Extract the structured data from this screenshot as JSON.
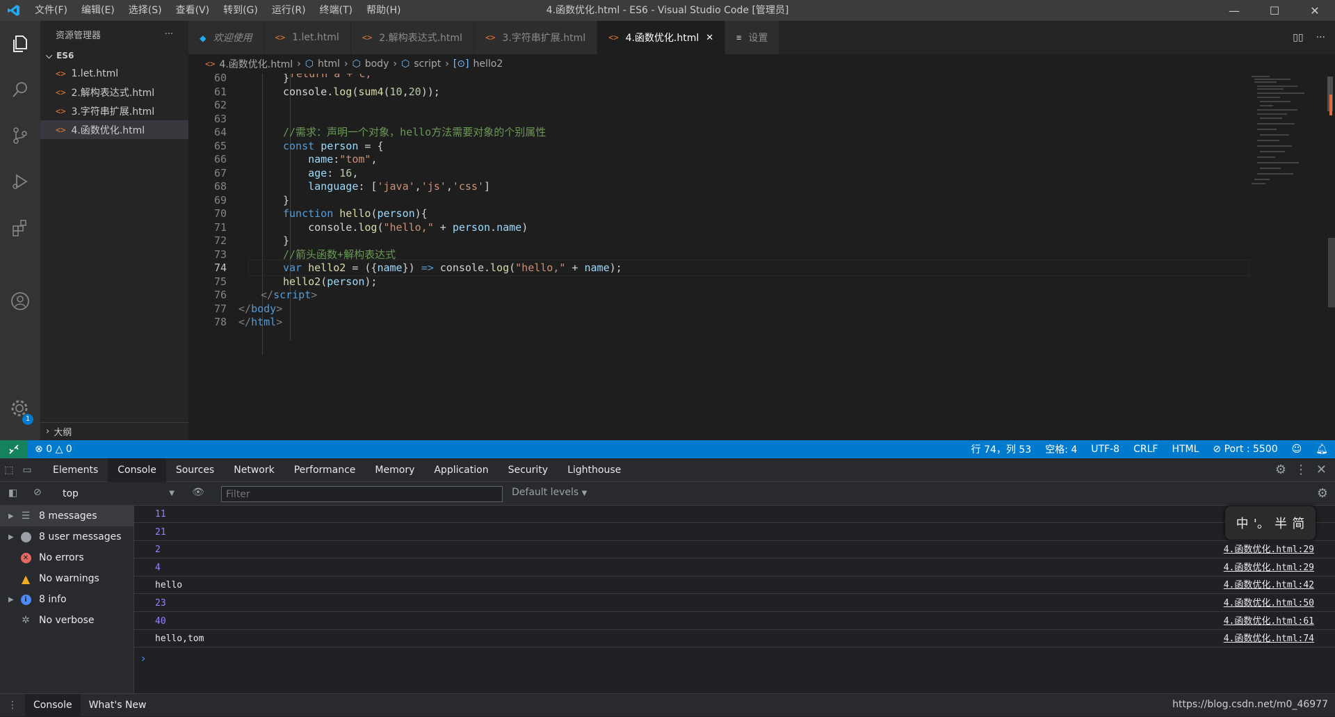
{
  "titlebar": {
    "menu": [
      "文件(F)",
      "编辑(E)",
      "选择(S)",
      "查看(V)",
      "转到(G)",
      "运行(R)",
      "终端(T)",
      "帮助(H)"
    ],
    "title": "4.函数优化.html - ES6 - Visual Studio Code [管理员]"
  },
  "sidebar": {
    "header": "资源管理器",
    "folder": "ES6",
    "files": [
      "1.let.html",
      "2.解构表达式.html",
      "3.字符串扩展.html",
      "4.函数优化.html"
    ],
    "outline": "大纲",
    "settings_badge": "1"
  },
  "tabs": [
    {
      "label": "欢迎使用",
      "icon": "vscode-icon"
    },
    {
      "label": "1.let.html",
      "icon": "html-icon"
    },
    {
      "label": "2.解构表达式.html",
      "icon": "html-icon"
    },
    {
      "label": "3.字符串扩展.html",
      "icon": "html-icon"
    },
    {
      "label": "4.函数优化.html",
      "icon": "html-icon"
    },
    {
      "label": "设置",
      "icon": "settings-file-icon"
    }
  ],
  "breadcrumb": {
    "file": "4.函数优化.html",
    "html": "html",
    "body": "body",
    "script": "script",
    "symbol": "hello2"
  },
  "editor": {
    "line_numbers": [
      "60",
      "61",
      "62",
      "63",
      "64",
      "65",
      "66",
      "67",
      "68",
      "69",
      "70",
      "71",
      "72",
      "73",
      "74",
      "75",
      "76",
      "77",
      "78"
    ],
    "lines": [
      [
        [
          "p",
          "}"
        ]
      ],
      [
        [
          "p",
          "console."
        ],
        [
          "fn",
          "log"
        ],
        [
          "p",
          "("
        ],
        [
          "fn",
          "sum4"
        ],
        [
          "p",
          "("
        ],
        [
          "num",
          "10"
        ],
        [
          "p",
          ","
        ],
        [
          "num",
          "20"
        ],
        [
          "p",
          "));"
        ]
      ],
      [],
      [],
      [
        [
          "cm",
          "//需求：声明一个对象，hello方法需要对象的个别属性"
        ]
      ],
      [
        [
          "kw",
          "const "
        ],
        [
          "var",
          "person"
        ],
        [
          "p",
          " = {"
        ]
      ],
      [
        [
          "p",
          "    "
        ],
        [
          "var",
          "name"
        ],
        [
          "p",
          ":"
        ],
        [
          "str",
          "\"tom\""
        ],
        [
          "p",
          ","
        ]
      ],
      [
        [
          "p",
          "    "
        ],
        [
          "var",
          "age"
        ],
        [
          "p",
          ": "
        ],
        [
          "num",
          "16"
        ],
        [
          "p",
          ","
        ]
      ],
      [
        [
          "p",
          "    "
        ],
        [
          "var",
          "language"
        ],
        [
          "p",
          ": ["
        ],
        [
          "str",
          "'java'"
        ],
        [
          "p",
          ","
        ],
        [
          "str",
          "'js'"
        ],
        [
          "p",
          ","
        ],
        [
          "str",
          "'css'"
        ],
        [
          "p",
          "]"
        ]
      ],
      [
        [
          "p",
          "}"
        ]
      ],
      [
        [
          "kw",
          "function "
        ],
        [
          "fn",
          "hello"
        ],
        [
          "p",
          "("
        ],
        [
          "var",
          "person"
        ],
        [
          "p",
          "){"
        ]
      ],
      [
        [
          "p",
          "    console."
        ],
        [
          "fn",
          "log"
        ],
        [
          "p",
          "("
        ],
        [
          "str",
          "\"hello,\""
        ],
        [
          "p",
          " + "
        ],
        [
          "var",
          "person"
        ],
        [
          "p",
          "."
        ],
        [
          "var",
          "name"
        ],
        [
          "p",
          ")"
        ]
      ],
      [
        [
          "p",
          "}"
        ]
      ],
      [
        [
          "cm",
          "//箭头函数+解构表达式"
        ]
      ],
      [
        [
          "kw",
          "var "
        ],
        [
          "fn",
          "hello2"
        ],
        [
          "p",
          " = ({"
        ],
        [
          "var",
          "name"
        ],
        [
          "p",
          "}) "
        ],
        [
          "kw",
          "=>"
        ],
        [
          "p",
          " console."
        ],
        [
          "fn",
          "log"
        ],
        [
          "p",
          "("
        ],
        [
          "str",
          "\"hello,\""
        ],
        [
          "p",
          " + "
        ],
        [
          "var",
          "name"
        ],
        [
          "p",
          ");"
        ]
      ],
      [
        [
          "fn",
          "hello2"
        ],
        [
          "p",
          "("
        ],
        [
          "var",
          "person"
        ],
        [
          "p",
          ");"
        ]
      ],
      [
        [
          "br",
          "</"
        ],
        [
          "tag",
          "script"
        ],
        [
          "br",
          ">"
        ]
      ],
      [
        [
          "br",
          "</"
        ],
        [
          "tag",
          "body"
        ],
        [
          "br",
          ">"
        ]
      ],
      [
        [
          "br",
          "</"
        ],
        [
          "tag",
          "html"
        ],
        [
          "br",
          ">"
        ]
      ]
    ],
    "top_partial": "return a + c;"
  },
  "status": {
    "errors": "0",
    "warnings": "0",
    "position": "行 74，列 53",
    "spaces": "空格: 4",
    "encoding": "UTF-8",
    "eol": "CRLF",
    "language": "HTML",
    "port": "Port : 5500"
  },
  "devtools": {
    "tabs": [
      "Elements",
      "Console",
      "Sources",
      "Network",
      "Performance",
      "Memory",
      "Application",
      "Security",
      "Lighthouse"
    ],
    "active_tab": "Console",
    "context": "top",
    "filter_placeholder": "Filter",
    "levels": "Default levels",
    "sidebar": [
      {
        "label": "8 messages",
        "icon": "list-icon",
        "expandable": true
      },
      {
        "label": "8 user messages",
        "icon": "user-icon",
        "expandable": true
      },
      {
        "label": "No errors",
        "icon": "error-icon",
        "expandable": false
      },
      {
        "label": "No warnings",
        "icon": "warning-icon",
        "expandable": false
      },
      {
        "label": "8 info",
        "icon": "info-icon",
        "expandable": true
      },
      {
        "label": "No verbose",
        "icon": "bug-icon",
        "expandable": false
      }
    ],
    "console_rows": [
      {
        "value": "11",
        "type": "number",
        "source": "4."
      },
      {
        "value": "21",
        "type": "number",
        "source": "4."
      },
      {
        "value": "2",
        "type": "number",
        "source": "4.函数优化.html:29"
      },
      {
        "value": "4",
        "type": "number",
        "source": "4.函数优化.html:29"
      },
      {
        "value": "hello",
        "type": "string",
        "source": "4.函数优化.html:42"
      },
      {
        "value": "23",
        "type": "number",
        "source": "4.函数优化.html:50"
      },
      {
        "value": "40",
        "type": "number",
        "source": "4.函数优化.html:61"
      },
      {
        "value": "hello,tom",
        "type": "string",
        "source": "4.函数优化.html:74"
      }
    ],
    "prompt": "›",
    "ime": [
      "中",
      "'。",
      "半",
      "简"
    ],
    "drawer_tabs": [
      "Console",
      "What's New"
    ]
  },
  "watermark": "https://blog.csdn.net/m0_46977",
  "colors": {
    "statusbar": "#007acc",
    "remote": "#16825d",
    "accent_file": "#e37933"
  }
}
